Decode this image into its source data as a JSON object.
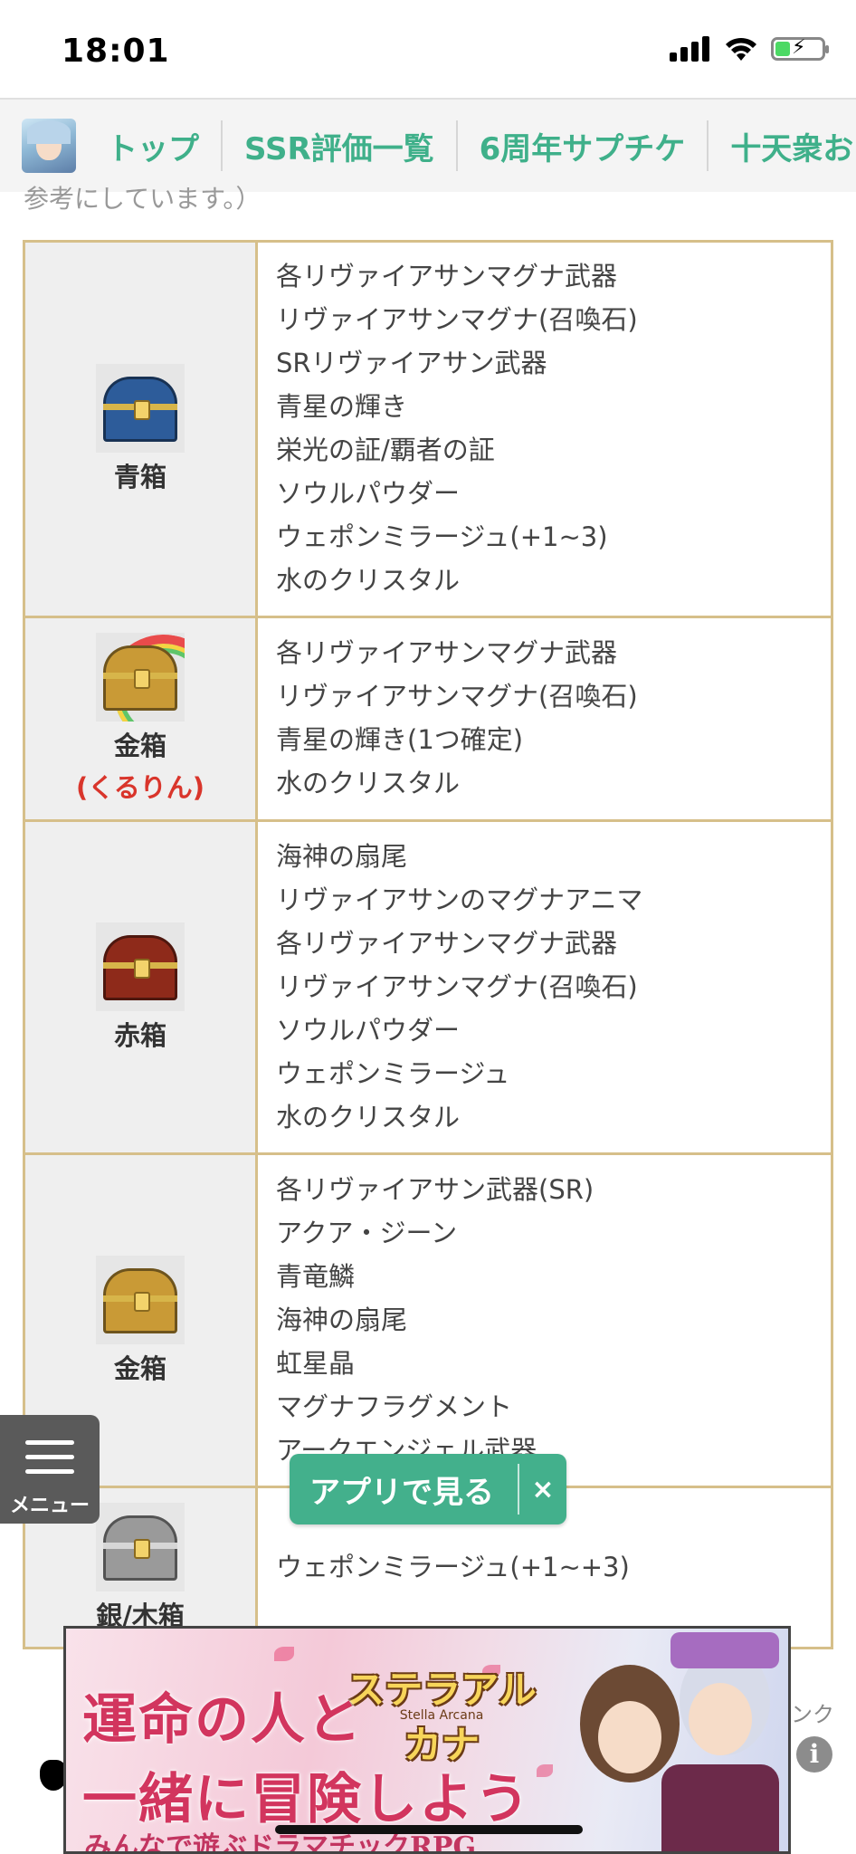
{
  "status_bar": {
    "time": "18:01"
  },
  "nav": {
    "items": [
      "トップ",
      "SSR評価一覧",
      "6周年サプチケ",
      "十天衆お"
    ]
  },
  "content": {
    "truncated_text": "参考にしています。）",
    "rows": [
      {
        "box_label": "青箱",
        "box_sublabel": "",
        "items": [
          "各リヴァイアサンマグナ武器",
          "リヴァイアサンマグナ(召喚石)",
          "SRリヴァイアサン武器",
          "青星の輝き",
          "栄光の証/覇者の証",
          "ソウルパウダー",
          "ウェポンミラージュ(+1~3)",
          "水のクリスタル"
        ]
      },
      {
        "box_label": "金箱",
        "box_sublabel": "(くるりん)",
        "items": [
          "各リヴァイアサンマグナ武器",
          "リヴァイアサンマグナ(召喚石)",
          "青星の輝き(1つ確定)",
          "水のクリスタル"
        ]
      },
      {
        "box_label": "赤箱",
        "box_sublabel": "",
        "items": [
          "海神の扇尾",
          "リヴァイアサンのマグナアニマ",
          "各リヴァイアサンマグナ武器",
          "リヴァイアサンマグナ(召喚石)",
          "ソウルパウダー",
          "ウェポンミラージュ",
          "水のクリスタル"
        ]
      },
      {
        "box_label": "金箱",
        "box_sublabel": "",
        "items": [
          "各リヴァイアサン武器(SR)",
          "アクア・ジーン",
          "青竜鱗",
          "海神の扇尾",
          "虹星晶",
          "マグナフラグメント",
          "アークエンジェル武器"
        ]
      },
      {
        "box_label": "銀/木箱",
        "box_sublabel": "",
        "items": [
          "ウェポンミラージュ(+1~+3)"
        ]
      }
    ]
  },
  "menu": {
    "label": "メニュー"
  },
  "app_button": {
    "label": "アプリで見る",
    "close": "×"
  },
  "ad": {
    "line1": "運命の人と",
    "line2": "一緒に冒険しよう",
    "line3": "みんなで遊ぶドラマチックRPG",
    "logo": "ステラアルカナ",
    "logo_sub": "Stella Arcana"
  },
  "side_link": "ンク",
  "info_icon": "i",
  "colors": {
    "accent": "#43b08c",
    "table_border": "#d6bf8a",
    "warning_red": "#d9352b"
  }
}
